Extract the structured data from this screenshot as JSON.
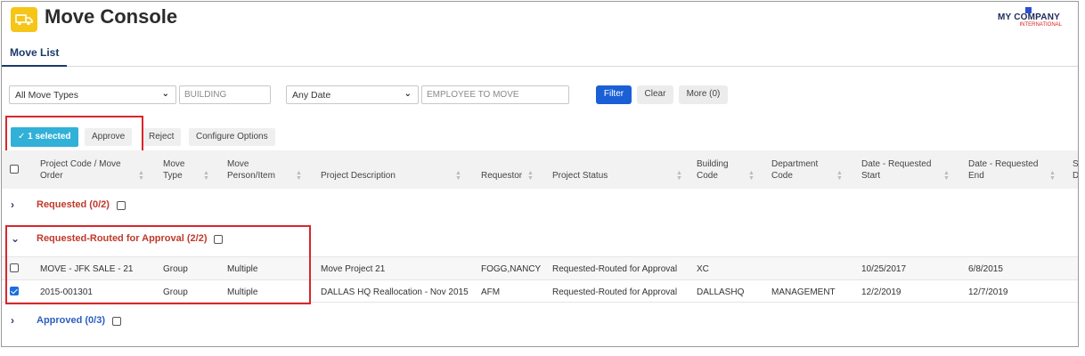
{
  "app": {
    "title": "Move Console",
    "icon": "truck-icon"
  },
  "logo": {
    "line1": "MY COMPANY",
    "line2": "INTERNATIONAL"
  },
  "tabs": [
    {
      "label": "Move List",
      "active": true
    }
  ],
  "filters": {
    "move_type": "All Move Types",
    "building_placeholder": "BUILDING",
    "date": "Any Date",
    "employee_placeholder": "EMPLOYEE TO MOVE",
    "filter_label": "Filter",
    "clear_label": "Clear",
    "more_label": "More (0)"
  },
  "actions": {
    "selected_label": "✓ 1 selected",
    "approve_label": "Approve",
    "reject_label": "Reject",
    "configure_label": "Configure Options"
  },
  "columns": [
    {
      "line1": "Project Code / Move",
      "line2": "Order"
    },
    {
      "line1": "Move",
      "line2": "Type"
    },
    {
      "line1": "Move",
      "line2": "Person/Item"
    },
    {
      "line1": "Project Description",
      "line2": ""
    },
    {
      "line1": "Requestor",
      "line2": ""
    },
    {
      "line1": "Project Status",
      "line2": ""
    },
    {
      "line1": "Building",
      "line2": "Code"
    },
    {
      "line1": "Department",
      "line2": "Code"
    },
    {
      "line1": "Date - Requested",
      "line2": "Start"
    },
    {
      "line1": "Date - Requested",
      "line2": "End"
    },
    {
      "line1": "Sc",
      "line2": "Da"
    }
  ],
  "groups": [
    {
      "label": "Requested (0/2)",
      "expanded": false,
      "color": "#c0392b"
    },
    {
      "label": "Requested-Routed for Approval (2/2)",
      "expanded": true,
      "color": "#c0392b"
    },
    {
      "label": "Approved (0/3)",
      "expanded": false,
      "color": "#2b5fbf"
    }
  ],
  "rows": [
    {
      "checked": false,
      "code": "MOVE - JFK SALE - 21",
      "type": "Group",
      "person": "Multiple",
      "description": "Move Project 21",
      "requestor": "FOGG,NANCY",
      "status": "Requested-Routed for Approval",
      "building": "XC",
      "department": "",
      "start": "10/25/2017",
      "end": "6/8/2015"
    },
    {
      "checked": true,
      "code": "2015-001301",
      "type": "Group",
      "person": "Multiple",
      "description": "DALLAS HQ Reallocation - Nov 2015",
      "requestor": "AFM",
      "status": "Requested-Routed for Approval",
      "building": "DALLASHQ",
      "department": "MANAGEMENT",
      "start": "12/2/2019",
      "end": "12/7/2019"
    }
  ]
}
